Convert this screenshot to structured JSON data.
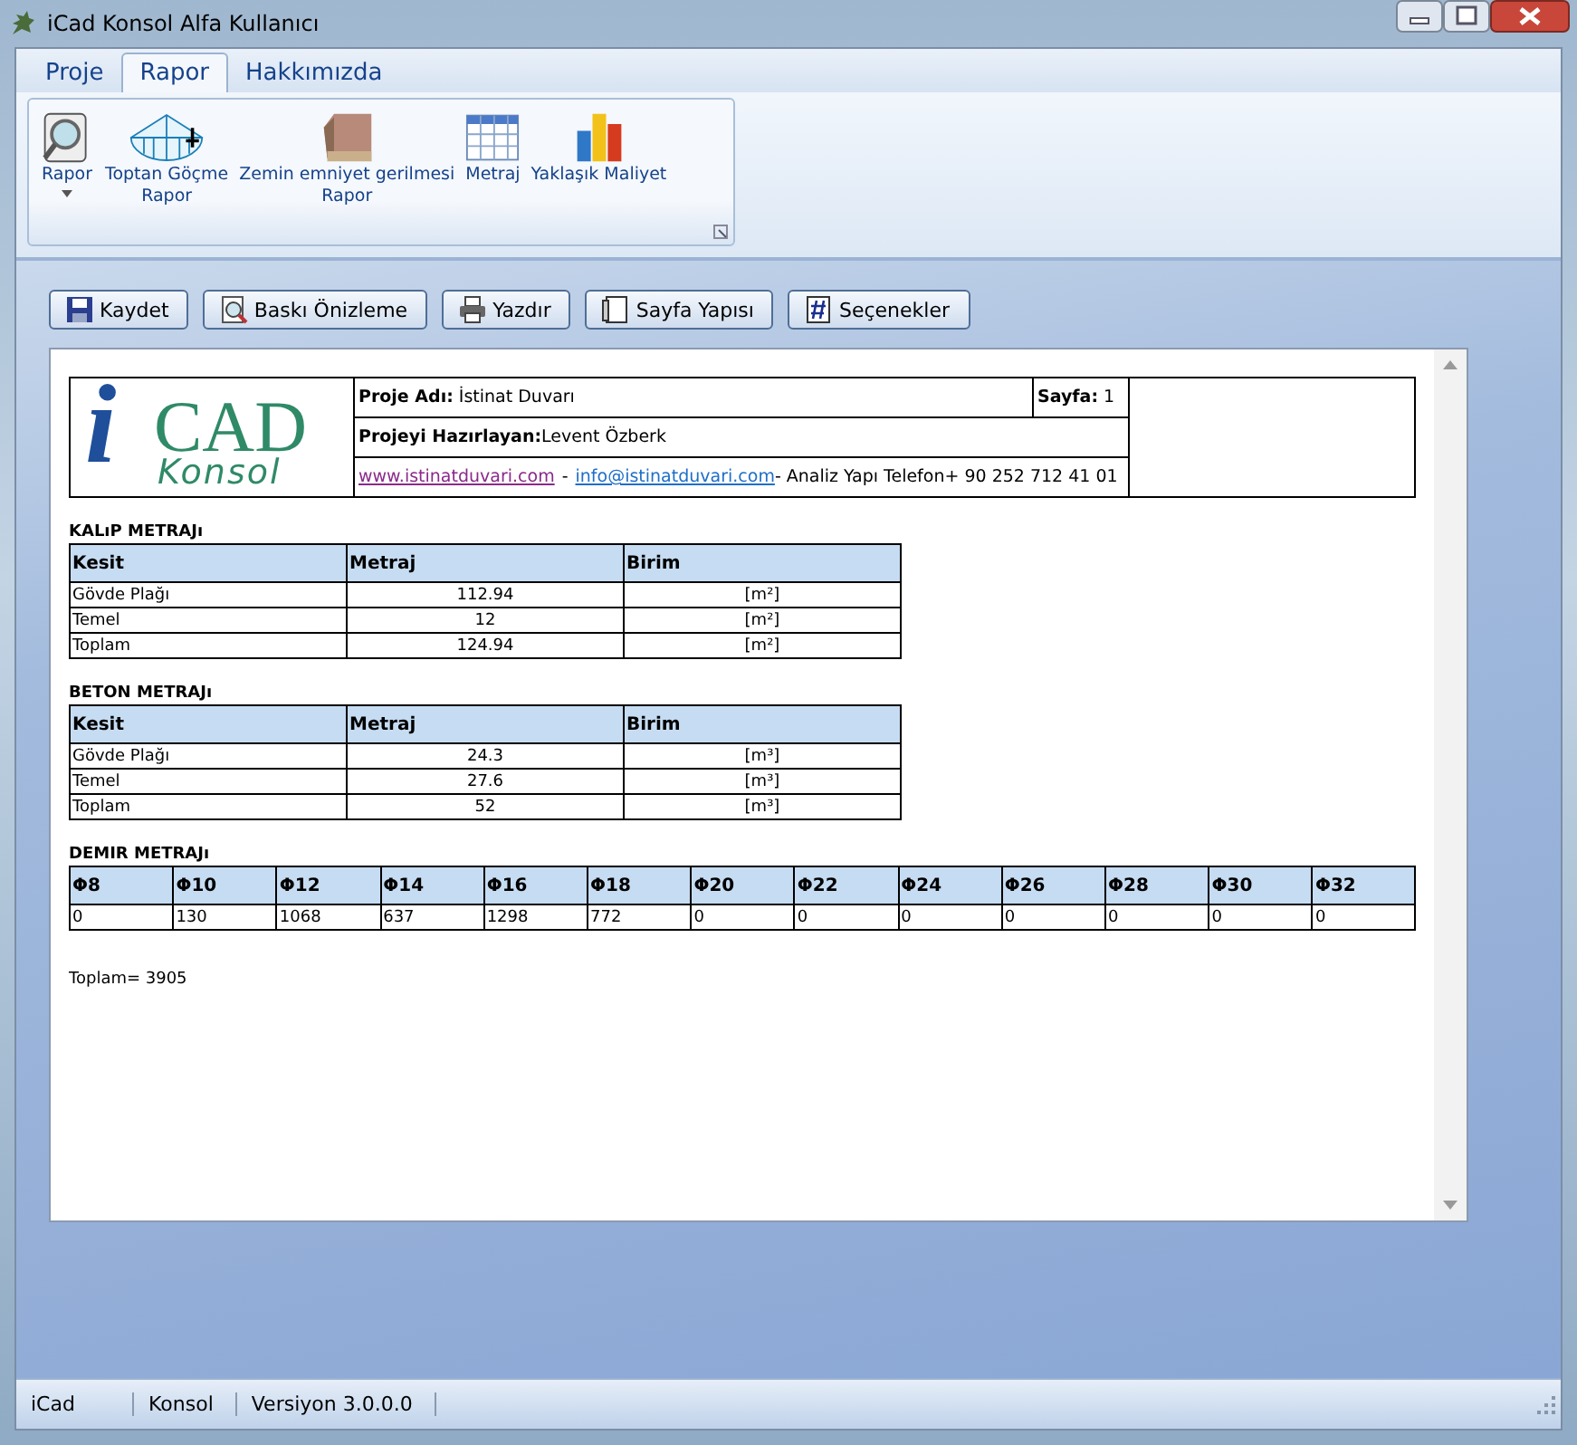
{
  "window": {
    "title": "iCad Konsol Alfa Kullanıcı"
  },
  "tabs": [
    {
      "label": "Proje",
      "selected": false
    },
    {
      "label": "Rapor",
      "selected": true
    },
    {
      "label": "Hakkımızda",
      "selected": false
    }
  ],
  "ribbon": [
    {
      "kind": "preview",
      "label": "Rapor",
      "dropdown": true
    },
    {
      "kind": "collapse",
      "label": "Toptan Göçme\nRapor",
      "dropdown": false
    },
    {
      "kind": "wall",
      "label": "Zemin emniyet gerilmesi\nRapor",
      "dropdown": false
    },
    {
      "kind": "grid",
      "label": "Metraj",
      "dropdown": false
    },
    {
      "kind": "chart",
      "label": "Yaklaşık Maliyet",
      "dropdown": false
    }
  ],
  "toolbar": [
    {
      "kind": "save",
      "label": "Kaydet"
    },
    {
      "kind": "preview",
      "label": "Baskı Önizleme"
    },
    {
      "kind": "print",
      "label": "Yazdır"
    },
    {
      "kind": "page",
      "label": "Sayfa Yapısı"
    },
    {
      "kind": "options",
      "label": "Seçenekler"
    }
  ],
  "report": {
    "logo": {
      "main": "CAD",
      "letter": "i",
      "sub": "Konsol"
    },
    "project_name": {
      "label": "Proje Adı:",
      "value": "İstinat Duvarı"
    },
    "page": {
      "label": "Sayfa:",
      "value": "1"
    },
    "author": {
      "label": "Projeyi Hazırlayan:",
      "value": "Levent Özberk"
    },
    "links": [
      {
        "text": "www.istinatduvari.com",
        "visited": true
      },
      {
        "text": "info@istinatduvari.com",
        "visited": false
      }
    ],
    "separator": "-",
    "contact": "- Analiz Yapı Telefon+ 90 252 712 41 01",
    "tables": [
      {
        "title": "KALıP METRAJı",
        "columns": [
          "Kesit",
          "Metraj",
          "Birim"
        ],
        "rows": [
          [
            "Gövde Plağı",
            "112.94",
            "[m²]"
          ],
          [
            "Temel",
            "12",
            "[m²]"
          ],
          [
            "Toplam",
            "124.94",
            "[m²]"
          ]
        ]
      },
      {
        "title": "BETON METRAJı",
        "columns": [
          "Kesit",
          "Metraj",
          "Birim"
        ],
        "rows": [
          [
            "Gövde Plağı",
            "24.3",
            "[m³]"
          ],
          [
            "Temel",
            "27.6",
            "[m³]"
          ],
          [
            "Toplam",
            "52",
            "[m³]"
          ]
        ]
      }
    ],
    "steel": {
      "title": "DEMIR METRAJı",
      "columns": [
        "Φ8",
        "Φ10",
        "Φ12",
        "Φ14",
        "Φ16",
        "Φ18",
        "Φ20",
        "Φ22",
        "Φ24",
        "Φ26",
        "Φ28",
        "Φ30",
        "Φ32"
      ],
      "values": [
        "0",
        "130",
        "1068",
        "637",
        "1298",
        "772",
        "0",
        "0",
        "0",
        "0",
        "0",
        "0",
        "0"
      ]
    },
    "total": "Toplam= 3905"
  },
  "status_bar": [
    "iCad",
    "Konsol",
    "Versiyon 3.0.0.0"
  ]
}
